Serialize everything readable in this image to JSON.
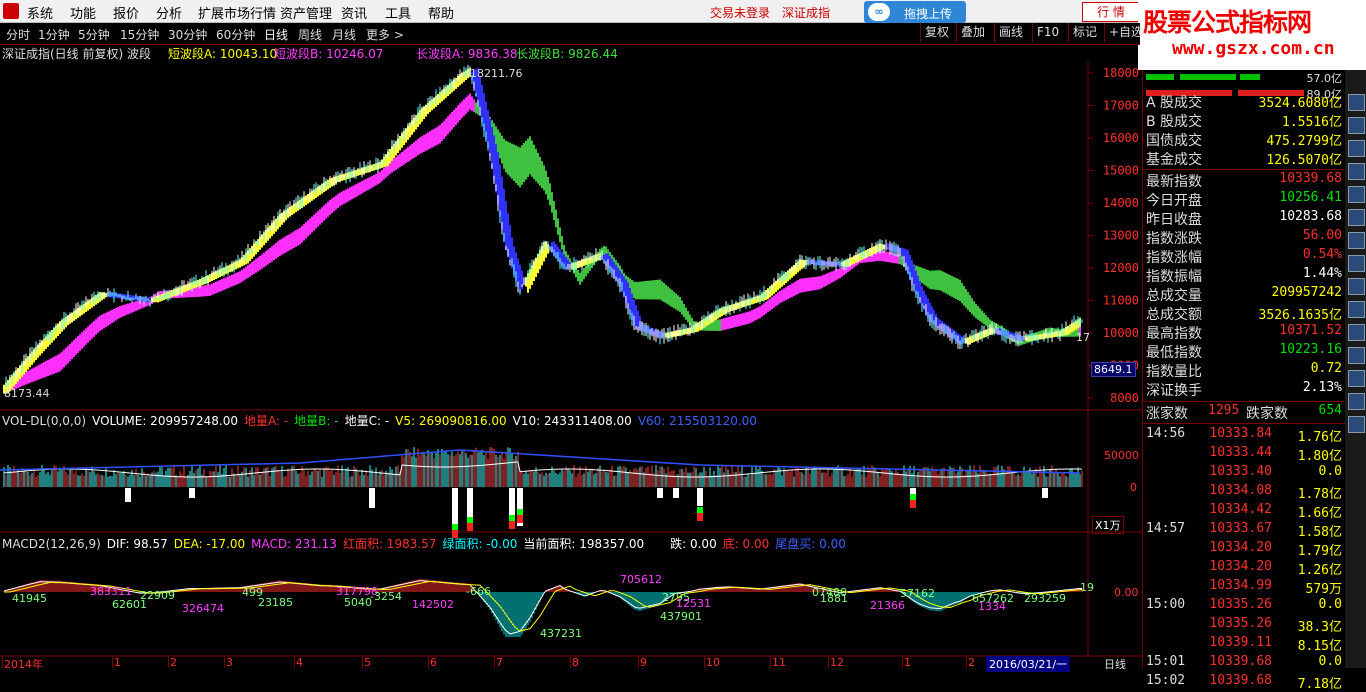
{
  "menu": {
    "items": [
      "系统",
      "功能",
      "报价",
      "分析",
      "扩展市场行情",
      "资产管理",
      "资讯",
      "工具",
      "帮助"
    ],
    "trade_status": "交易未登录",
    "index_name": "深证成指",
    "upload_label": "拖拽上传",
    "quote_tab": "行 情"
  },
  "watermark": {
    "title": "股票公式指标网",
    "url": "www.gszx.com.cn"
  },
  "periods": {
    "items": [
      "分时",
      "1分钟",
      "5分钟",
      "15分钟",
      "30分钟",
      "60分钟",
      "日线",
      "周线",
      "月线",
      "更多 >"
    ],
    "active_index": 6
  },
  "right_buttons": [
    "复权",
    "叠加",
    "画线",
    "F10",
    "标记",
    "+自选"
  ],
  "chart_title": {
    "main": "深证成指(日线 前复权) 波段",
    "short_a": "短波段A: 10043.10",
    "short_b": "短波段B: 10246.07",
    "long_a": "长波段A: 9836.38",
    "long_b": "长波段B: 9826.44"
  },
  "price_axis": {
    "ticks": [
      "18000",
      "17000",
      "16000",
      "15000",
      "14000",
      "13000",
      "12000",
      "11000",
      "10000",
      "9000",
      "8000"
    ],
    "tick_values": [
      18000,
      17000,
      16000,
      15000,
      14000,
      13000,
      12000,
      11000,
      10000,
      9000,
      8000
    ],
    "current_label": "8649.1"
  },
  "annotations": {
    "high": "18211.76",
    "low": "8173.44",
    "last": "17"
  },
  "volume_panel": {
    "title": "VOL-DL(0,0,0)",
    "volume": "VOLUME: 209957248.00",
    "dia": "地量A: -",
    "dib": "地量B: -",
    "dic": "地量C: -",
    "v5": "V5: 269090816.00",
    "v10": "V10: 243311408.00",
    "v60": "V60: 215503120.00",
    "axis_50000": "50000",
    "axis_0": "0",
    "unit": "X1万"
  },
  "macd_panel": {
    "title": "MACD2(12,26,9)",
    "dif": "DIF: 98.57",
    "dea": "DEA: -17.00",
    "macd": "MACD: 231.13",
    "red_area": "红面积: 1983.57",
    "green_area": "绿面积: -0.00",
    "current_area": "当前面积: 198357.00",
    "jump": "跌: 0.00",
    "bottom": "底: 0.00",
    "tail": "尾盘买: 0.00",
    "axis_zero": "0.00",
    "labels": [
      "41945",
      "383311",
      "62601",
      "22909",
      "326474",
      "499",
      "23185",
      "317798",
      "5040",
      "-3254",
      "142502",
      "-666",
      "437231",
      "705612",
      "2795",
      "437901",
      "12531",
      "07480",
      "1881",
      "21366",
      "57162",
      "657262",
      "1334",
      "293259",
      "19"
    ]
  },
  "date_axis": {
    "labels": [
      "2014年",
      "1",
      "2",
      "3",
      "4",
      "5",
      "6",
      "7",
      "8",
      "9",
      "10",
      "11",
      "12",
      "1",
      "2",
      "3"
    ],
    "cursor_date": "2016/03/21/一",
    "period_label": "日线"
  },
  "right_panel": {
    "bar_values": [
      "57.0亿",
      "89.0亿"
    ],
    "turnover": [
      {
        "label": "A 股成交",
        "value": "3524.6080亿"
      },
      {
        "label": "B 股成交",
        "value": "1.5516亿"
      },
      {
        "label": "国债成交",
        "value": "475.2799亿"
      },
      {
        "label": "基金成交",
        "value": "126.5070亿"
      }
    ],
    "stats": [
      {
        "label": "最新指数",
        "value": "10339.68",
        "color": "red"
      },
      {
        "label": "今日开盘",
        "value": "10256.41",
        "color": "green"
      },
      {
        "label": "昨日收盘",
        "value": "10283.68",
        "color": "white"
      },
      {
        "label": "指数涨跌",
        "value": "56.00",
        "color": "red"
      },
      {
        "label": "指数涨幅",
        "value": "0.54%",
        "color": "red"
      },
      {
        "label": "指数振幅",
        "value": "1.44%",
        "color": "white"
      },
      {
        "label": "总成交量",
        "value": "209957242",
        "color": "yellow"
      },
      {
        "label": "总成交额",
        "value": "3526.1635亿",
        "color": "yellow"
      },
      {
        "label": "最高指数",
        "value": "10371.52",
        "color": "red"
      },
      {
        "label": "最低指数",
        "value": "10223.16",
        "color": "green"
      },
      {
        "label": "指数量比",
        "value": "0.72",
        "color": "yellow"
      },
      {
        "label": "深证换手",
        "value": "2.13%",
        "color": "white"
      }
    ],
    "breadth": {
      "up_label": "涨家数",
      "up": "1295",
      "down_label": "跌家数",
      "down": "654"
    },
    "ticks": [
      {
        "time": "14:56",
        "price": "10333.84",
        "vol": "1.76亿"
      },
      {
        "time": "",
        "price": "10333.44",
        "vol": "1.80亿"
      },
      {
        "time": "",
        "price": "10333.40",
        "vol": "0.0"
      },
      {
        "time": "",
        "price": "10334.08",
        "vol": "1.78亿"
      },
      {
        "time": "",
        "price": "10334.42",
        "vol": "1.66亿"
      },
      {
        "time": "14:57",
        "price": "10333.67",
        "vol": "1.58亿"
      },
      {
        "time": "",
        "price": "10334.20",
        "vol": "1.79亿"
      },
      {
        "time": "",
        "price": "10334.20",
        "vol": "1.26亿"
      },
      {
        "time": "",
        "price": "10334.99",
        "vol": "579万"
      },
      {
        "time": "15:00",
        "price": "10335.26",
        "vol": "0.0"
      },
      {
        "time": "",
        "price": "10335.26",
        "vol": "38.3亿"
      },
      {
        "time": "",
        "price": "10339.11",
        "vol": "8.15亿"
      },
      {
        "time": "15:01",
        "price": "10339.68",
        "vol": "0.0"
      },
      {
        "time": "15:02",
        "price": "10339.68",
        "vol": "7.18亿"
      }
    ]
  },
  "tool_icons": [
    "Fn-icon",
    "box-icon",
    "chart-icon",
    "candle-icon",
    "F10-icon",
    "grid-icon",
    "F9-icon",
    "Fz-icon",
    "table-icon",
    "chart2-icon",
    "RSI-icon",
    "arrow-up-icon",
    "arrow-updown-icon",
    "chart3-icon",
    "chart4-icon"
  ],
  "colors": {
    "up": "#ff3030",
    "down": "#00e000",
    "axis": "#7a0000",
    "yellow_band": "#ffff30",
    "magenta_band": "#ff30ff",
    "green_band": "#40c040",
    "blue_band": "#3030ff"
  }
}
